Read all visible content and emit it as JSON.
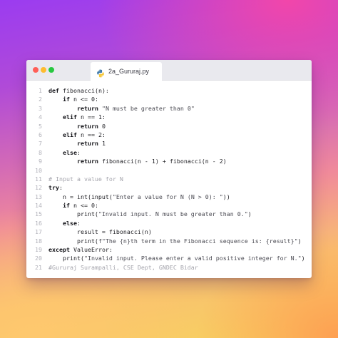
{
  "window": {
    "tab_title": "2a_Gururaj.py",
    "tab_icon": "python-icon",
    "controls": [
      "close-icon",
      "minimize-icon",
      "maximize-icon"
    ]
  },
  "code": {
    "lines": [
      {
        "n": "1",
        "segments": [
          {
            "t": "def",
            "k": "kw"
          },
          {
            "t": " fibonacci(n):",
            "k": "src"
          }
        ]
      },
      {
        "n": "2",
        "segments": [
          {
            "t": "    ",
            "k": "src"
          },
          {
            "t": "if",
            "k": "kw"
          },
          {
            "t": " n <= 0:",
            "k": "src"
          }
        ]
      },
      {
        "n": "3",
        "segments": [
          {
            "t": "        ",
            "k": "src"
          },
          {
            "t": "return",
            "k": "kw"
          },
          {
            "t": " ",
            "k": "src"
          },
          {
            "t": "\"N must be greater than 0\"",
            "k": "str"
          }
        ]
      },
      {
        "n": "4",
        "segments": [
          {
            "t": "    ",
            "k": "src"
          },
          {
            "t": "elif",
            "k": "kw"
          },
          {
            "t": " n == 1:",
            "k": "src"
          }
        ]
      },
      {
        "n": "5",
        "segments": [
          {
            "t": "        ",
            "k": "src"
          },
          {
            "t": "return",
            "k": "kw"
          },
          {
            "t": " 0",
            "k": "src"
          }
        ]
      },
      {
        "n": "6",
        "segments": [
          {
            "t": "    ",
            "k": "src"
          },
          {
            "t": "elif",
            "k": "kw"
          },
          {
            "t": " n == 2:",
            "k": "src"
          }
        ]
      },
      {
        "n": "7",
        "segments": [
          {
            "t": "        ",
            "k": "src"
          },
          {
            "t": "return",
            "k": "kw"
          },
          {
            "t": " 1",
            "k": "src"
          }
        ]
      },
      {
        "n": "8",
        "segments": [
          {
            "t": "    ",
            "k": "src"
          },
          {
            "t": "else",
            "k": "kw"
          },
          {
            "t": ":",
            "k": "src"
          }
        ]
      },
      {
        "n": "9",
        "segments": [
          {
            "t": "        ",
            "k": "src"
          },
          {
            "t": "return",
            "k": "kw"
          },
          {
            "t": " fibonacci(n - 1) + fibonacci(n - 2)",
            "k": "src"
          }
        ]
      },
      {
        "n": "10",
        "segments": []
      },
      {
        "n": "11",
        "segments": [
          {
            "t": "# Input a value for N",
            "k": "cmt"
          }
        ]
      },
      {
        "n": "12",
        "segments": [
          {
            "t": "try",
            "k": "kw"
          },
          {
            "t": ":",
            "k": "src"
          }
        ]
      },
      {
        "n": "13",
        "segments": [
          {
            "t": "    n = int(input(",
            "k": "src"
          },
          {
            "t": "\"Enter a value for N (N > 0): \"",
            "k": "str"
          },
          {
            "t": "))",
            "k": "src"
          }
        ]
      },
      {
        "n": "14",
        "segments": [
          {
            "t": "    ",
            "k": "src"
          },
          {
            "t": "if",
            "k": "kw"
          },
          {
            "t": " n <= 0:",
            "k": "src"
          }
        ]
      },
      {
        "n": "15",
        "segments": [
          {
            "t": "        print(",
            "k": "src"
          },
          {
            "t": "\"Invalid input. N must be greater than 0.\"",
            "k": "str"
          },
          {
            "t": ")",
            "k": "src"
          }
        ]
      },
      {
        "n": "16",
        "segments": [
          {
            "t": "    ",
            "k": "src"
          },
          {
            "t": "else",
            "k": "kw"
          },
          {
            "t": ":",
            "k": "src"
          }
        ]
      },
      {
        "n": "17",
        "segments": [
          {
            "t": "        result = fibonacci(n)",
            "k": "src"
          }
        ]
      },
      {
        "n": "18",
        "segments": [
          {
            "t": "        print(",
            "k": "src"
          },
          {
            "t": "f\"The {n}th term in the Fibonacci sequence is: {result}\"",
            "k": "str"
          },
          {
            "t": ")",
            "k": "src"
          }
        ]
      },
      {
        "n": "19",
        "segments": [
          {
            "t": "except",
            "k": "kw"
          },
          {
            "t": " ValueError:",
            "k": "src"
          }
        ]
      },
      {
        "n": "20",
        "segments": [
          {
            "t": "    print(",
            "k": "src"
          },
          {
            "t": "\"Invalid input. Please enter a valid positive integer for N.\"",
            "k": "str"
          },
          {
            "t": ")",
            "k": "src"
          }
        ]
      },
      {
        "n": "21",
        "segments": [
          {
            "t": "#Gururaj Surampalli, CSE Dept, GNDEC Bidar",
            "k": "cmt"
          }
        ]
      }
    ]
  }
}
